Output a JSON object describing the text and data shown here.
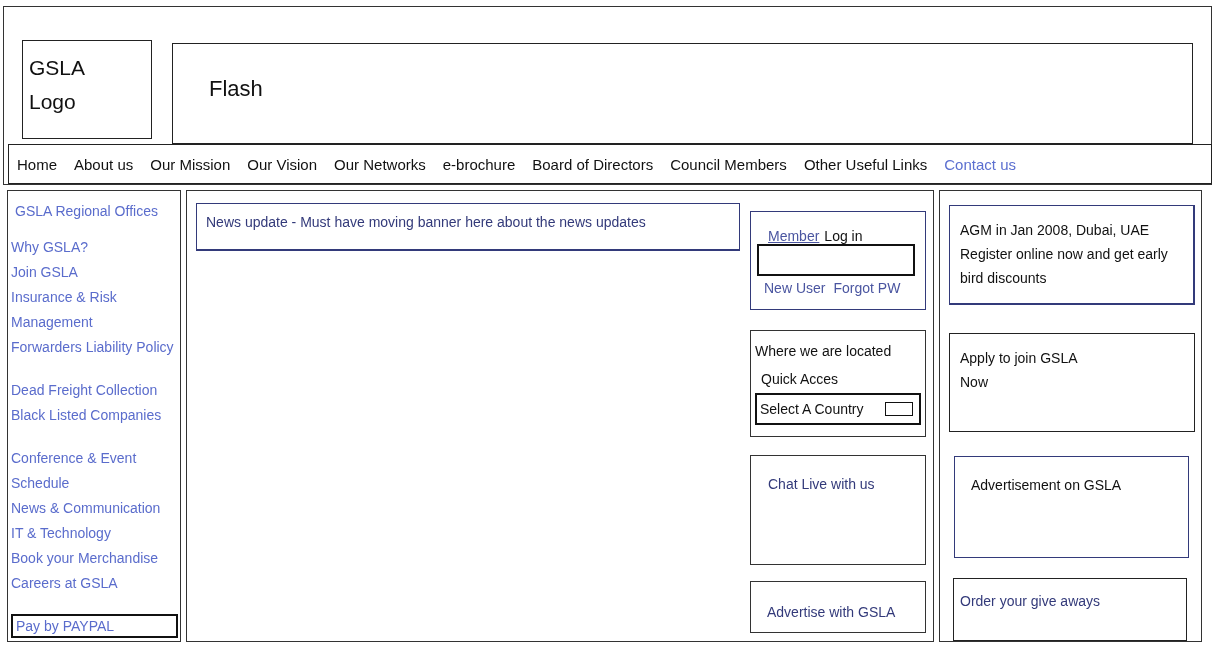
{
  "header": {
    "logo": [
      "GSLA",
      "Logo"
    ],
    "flash": "Flash"
  },
  "nav": [
    {
      "label": "Home",
      "kind": "item"
    },
    {
      "label": "About us",
      "kind": "item"
    },
    {
      "label": "Our Mission",
      "kind": "item"
    },
    {
      "label": "Our Vision",
      "kind": "item"
    },
    {
      "label": "Our Networks",
      "kind": "item"
    },
    {
      "label": "e-brochure",
      "kind": "item"
    },
    {
      "label": "Board of Directors",
      "kind": "item"
    },
    {
      "label": "Council Members",
      "kind": "item"
    },
    {
      "label": "Other Useful Links",
      "kind": "item"
    },
    {
      "label": "Contact us",
      "kind": "link"
    }
  ],
  "sidebar": {
    "title": "GSLA Regional Offices",
    "groups": [
      [
        "Why GSLA?",
        "Join GSLA",
        "Insurance & Risk Management",
        "Forwarders Liability Policy"
      ],
      [
        "Dead Freight Collection",
        "Black Listed Companies"
      ],
      [
        "Conference & Event Schedule",
        "News & Communication",
        "IT & Technology",
        "Book your Merchandise",
        "Careers at GSLA"
      ]
    ],
    "paypal": "Pay by PAYPAL"
  },
  "news_banner": "News update - Must have moving banner here about the news updates",
  "login": {
    "member": "Member",
    "log_in": "Log in",
    "new_user": "New User",
    "forgot": "Forgot PW"
  },
  "location": {
    "title": "Where we are located",
    "quick": "Quick Acces",
    "select": "Select A Country"
  },
  "chat": "Chat Live with us",
  "advertise": "Advertise with GSLA",
  "right_boxes": [
    {
      "kind": "dark",
      "lines": [
        "AGM in Jan 2008, Dubai, UAE",
        "Register online now and get early bird discounts"
      ]
    },
    {
      "kind": "dark",
      "lines": [
        "Apply to join GSLA",
        "Now"
      ]
    },
    {
      "kind": "dark",
      "lines": [
        "Advertisement on GSLA"
      ]
    },
    {
      "kind": "blue",
      "lines": [
        "Order your give aways"
      ]
    }
  ]
}
